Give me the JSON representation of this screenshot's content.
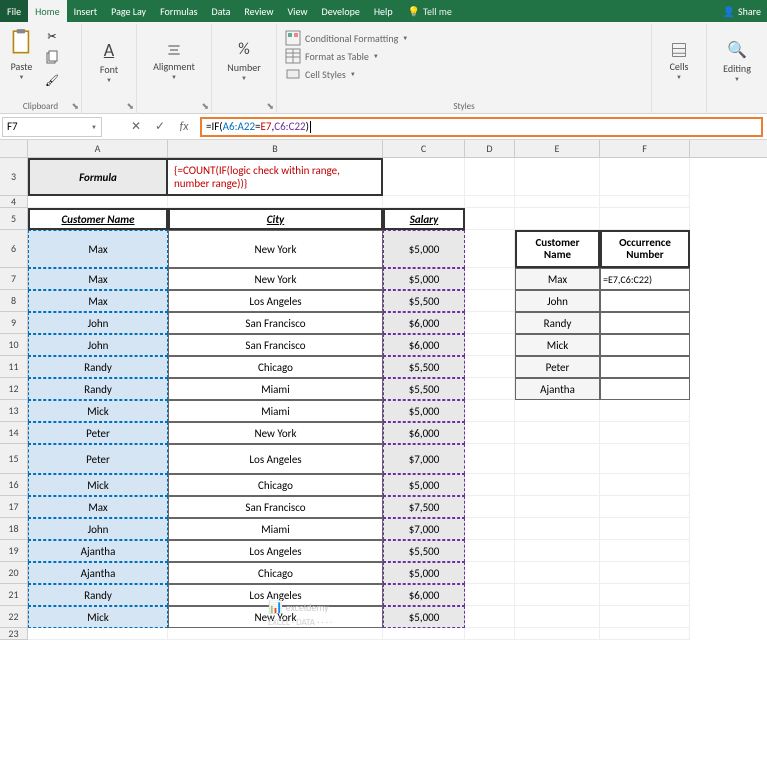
{
  "menu": {
    "file": "File",
    "home": "Home",
    "insert": "Insert",
    "pagelayout": "Page Lay",
    "formulas": "Formulas",
    "data": "Data",
    "review": "Review",
    "view": "View",
    "developer": "Develope",
    "help": "Help",
    "tellme": "Tell me",
    "share": "Share"
  },
  "ribbon": {
    "paste": "Paste",
    "clipboard": "Clipboard",
    "font": "Font",
    "alignment": "Alignment",
    "number": "Number",
    "cond_format": "Conditional Formatting",
    "format_table": "Format as Table",
    "cell_styles": "Cell Styles",
    "styles": "Styles",
    "cells": "Cells",
    "editing": "Editing"
  },
  "namebox": "F7",
  "fx_label": "fx",
  "formula": {
    "pre": "=IF(",
    "r1": "A6:A22",
    "eq": "=",
    "r2": "E7",
    "comma": ",",
    "r3": "C6:C22",
    "post": ")"
  },
  "cols": {
    "a": "A",
    "b": "B",
    "c": "C",
    "d": "D",
    "e": "E",
    "f": "F"
  },
  "rownums": [
    "3",
    "4",
    "5",
    "6",
    "7",
    "8",
    "9",
    "10",
    "11",
    "12",
    "13",
    "14",
    "15",
    "16",
    "17",
    "18",
    "19",
    "20",
    "21",
    "22",
    "23"
  ],
  "formula_label": "Formula",
  "formula_desc_1": "{=COUNT(IF(logic check within range,",
  "formula_desc_2": "number range))}",
  "headers": {
    "name": "Customer Name",
    "city": "City",
    "salary": "Salary"
  },
  "main_table": [
    {
      "name": "Max",
      "city": "New York",
      "salary": "$5,000"
    },
    {
      "name": "Max",
      "city": "New York",
      "salary": "$5,000"
    },
    {
      "name": "Max",
      "city": "Los Angeles",
      "salary": "$5,500"
    },
    {
      "name": "John",
      "city": "San Francisco",
      "salary": "$6,000"
    },
    {
      "name": "John",
      "city": "San Francisco",
      "salary": "$6,000"
    },
    {
      "name": "Randy",
      "city": "Chicago",
      "salary": "$5,500"
    },
    {
      "name": "Randy",
      "city": "Miami",
      "salary": "$5,500"
    },
    {
      "name": "Mick",
      "city": "Miami",
      "salary": "$5,000"
    },
    {
      "name": "Peter",
      "city": "New York",
      "salary": "$6,000"
    },
    {
      "name": "Peter",
      "city": "Los Angeles",
      "salary": "$7,000"
    },
    {
      "name": "Mick",
      "city": "Chicago",
      "salary": "$5,000"
    },
    {
      "name": "Max",
      "city": "San Francisco",
      "salary": "$7,500"
    },
    {
      "name": "John",
      "city": "Miami",
      "salary": "$7,000"
    },
    {
      "name": "Ajantha",
      "city": "Los Angeles",
      "salary": "$5,500"
    },
    {
      "name": "Ajantha",
      "city": "Chicago",
      "salary": "$5,000"
    },
    {
      "name": "Randy",
      "city": "Los Angeles",
      "salary": "$6,000"
    },
    {
      "name": "Mick",
      "city": "New York",
      "salary": "$5,000"
    }
  ],
  "right_headers": {
    "name": "Customer Name",
    "occ": "Occurrence Number"
  },
  "right_table": [
    "Max",
    "John",
    "Randy",
    "Mick",
    "Peter",
    "Ajantha"
  ],
  "f7_display": "=E7,C6:C22)",
  "watermark": {
    "main": "exceldemy",
    "sub": "EXCEL · DATA · · · ·"
  }
}
